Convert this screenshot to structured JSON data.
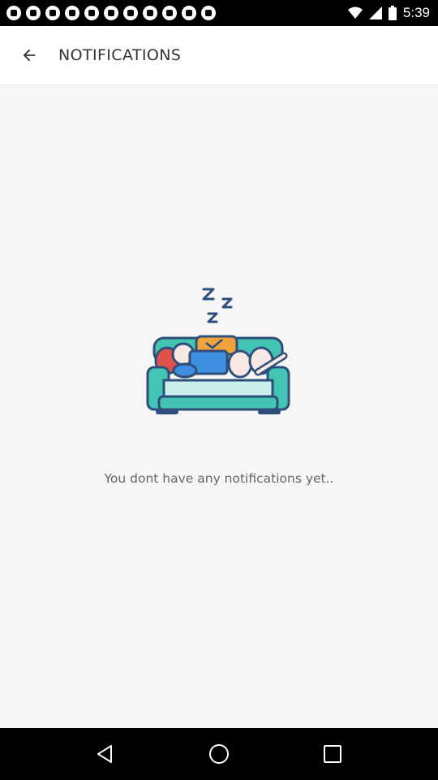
{
  "status_bar": {
    "time": "5:39",
    "notification_icons": [
      "cat-icon",
      "cat-icon",
      "cat-icon",
      "cat-icon",
      "bitcoin-icon",
      "cat-icon",
      "esc-icon",
      "cat-icon",
      "cat-icon",
      "cat-icon",
      "pinterest-icon"
    ],
    "system_icons": [
      "wifi-icon",
      "signal-icon",
      "battery-icon"
    ]
  },
  "header": {
    "back_icon": "arrow-left-icon",
    "title": "NOTIFICATIONS"
  },
  "empty_state": {
    "illustration": "sleeping-on-couch-illustration",
    "sleep_text": "Zzz",
    "message": "You dont have any notifications yet.."
  },
  "nav_bar": {
    "buttons": [
      "back-triangle-icon",
      "home-circle-icon",
      "recents-square-icon"
    ]
  },
  "colors": {
    "couch": "#42c6b3",
    "couch_dark": "#2f4f7a",
    "accent_orange": "#f0a33a",
    "shirt_blue": "#3f8fe0",
    "pillow_red": "#e2504a"
  }
}
